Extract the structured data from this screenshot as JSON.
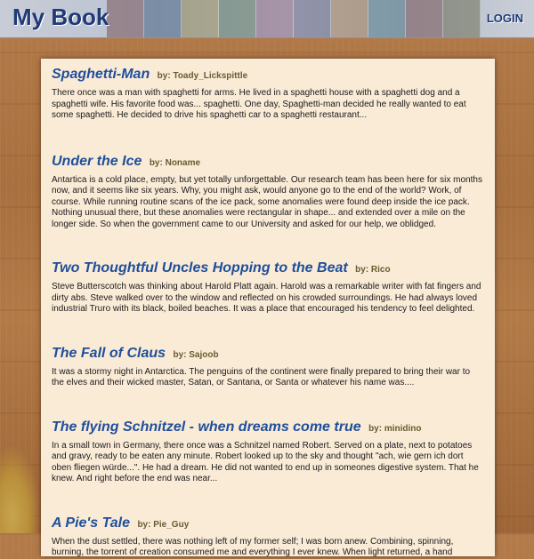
{
  "header": {
    "logo": "My Book",
    "login_label": "LOGIN"
  },
  "colors": {
    "brand_blue": "#203a78",
    "title_blue": "#1f4f9a",
    "author_brown": "#6a5a30",
    "card_bg": "#faebd7"
  },
  "posts": [
    {
      "title": "Spaghetti-Man",
      "author": "by: Toady_Lickspittle",
      "excerpt": "There once was a man with spaghetti for arms. He lived in a spaghetti house with a spaghetti dog and a spaghetti wife. His favorite food was... spaghetti. One day, Spaghetti-man decided he really wanted to eat some spaghetti. He decided to drive his spaghetti car to a spaghetti restaurant..."
    },
    {
      "title": "Under the Ice",
      "author": "by: Noname",
      "excerpt": "Antartica is a cold place, empty, but yet totally unforgettable. Our research team has been here for six months now, and it seems like six years. Why, you might ask, would anyone go to the end of the world? Work, of course. While running routine scans of the ice pack, some anomalies were found deep inside the ice pack. Nothing unusual there, but these anomalies were rectangular in shape... and extended over a mile on the longer side. So when the government came to our University and asked for our help, we oblidged."
    },
    {
      "title": "Two Thoughtful Uncles Hopping to the Beat",
      "author": "by: Rico",
      "excerpt": "Steve Butterscotch was thinking about Harold Platt again. Harold was a remarkable writer with fat fingers and dirty abs. Steve walked over to the window and reflected on his crowded surroundings. He had always loved industrial Truro with its black, boiled beaches. It was a place that encouraged his tendency to feel delighted."
    },
    {
      "title": "The Fall of Claus",
      "author": "by: Sajoob",
      "excerpt": "It was a stormy night in Antarctica. The penguins of the continent were finally prepared to bring their war to the elves and their wicked master, Satan, or Santana, or Santa or whatever his name was...."
    },
    {
      "title": "The flying Schnitzel - when dreams come true",
      "author": "by: minidino",
      "excerpt": "In a small town in Germany, there once was a Schnitzel named Robert. Served on a plate, next to potatoes and gravy, ready to be eaten any minute. Robert looked up to the sky and thought \"ach, wie gern ich dort oben fliegen würde...\". He had a dream. He did not wanted to end up in someones digestive system. That he knew. And right before the end was near..."
    },
    {
      "title": "A Pie's Tale",
      "author": "by: Pie_Guy",
      "excerpt": "When the dust settled, there was nothing left of my former self; I was born anew. Combining, spinning, burning, the torrent of creation consumed me and everything I ever knew. When light returned, a hand"
    }
  ]
}
